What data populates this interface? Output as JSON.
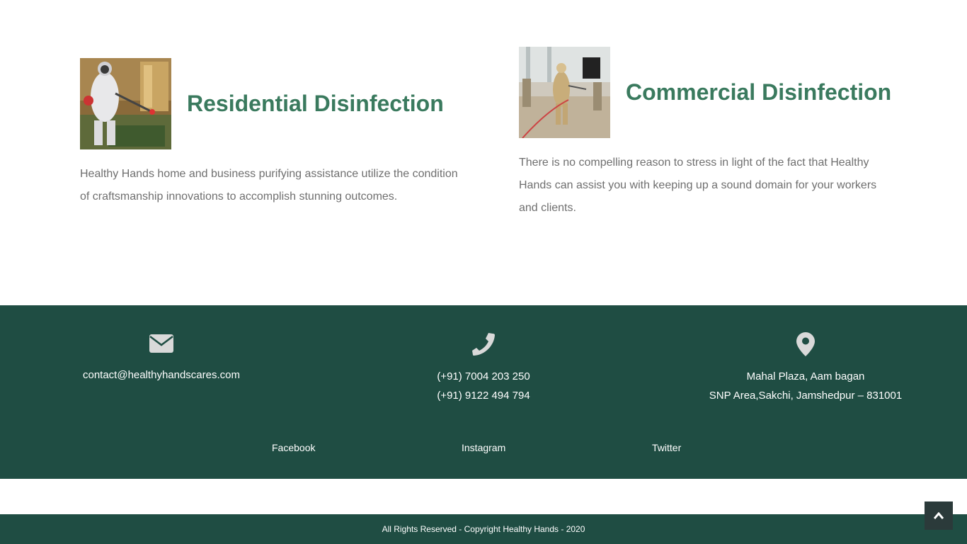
{
  "services": [
    {
      "title": "Residential Disinfection",
      "description": "Healthy Hands home and business purifying assistance utilize the condition of craftsmanship innovations to accomplish stunning outcomes."
    },
    {
      "title": "Commercial Disinfection",
      "description": "There is no compelling reason to stress in light of the fact that Healthy Hands can assist you with keeping up a sound domain for your workers and clients."
    }
  ],
  "contact": {
    "email": {
      "icon": "envelope-icon",
      "lines": [
        "contact@healthyhandscares.com"
      ]
    },
    "phone": {
      "icon": "phone-icon",
      "lines": [
        "(+91) 7004 203 250",
        "(+91) 9122 494 794"
      ]
    },
    "address": {
      "icon": "map-marker-icon",
      "lines": [
        "Mahal Plaza, Aam bagan",
        "SNP Area,Sakchi, Jamshedpur – 831001"
      ]
    }
  },
  "social": {
    "facebook": "Facebook",
    "instagram": "Instagram",
    "twitter": "Twitter"
  },
  "copyright": "All Rights Reserved - Copyright Healthy Hands - 2020",
  "colors": {
    "heading": "#3a7a5e",
    "footer_bg": "#1f4d43",
    "body_text": "#6f6f6f",
    "icon": "#d9d9d9"
  }
}
